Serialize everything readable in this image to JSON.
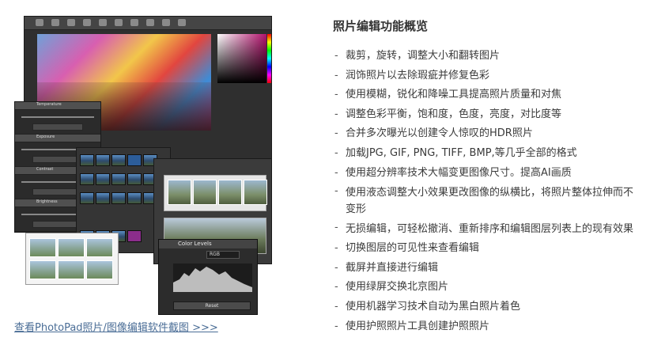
{
  "screenshot_link": {
    "text": "查看PhotoPad照片/图像编辑软件截图 >>>"
  },
  "embedded_screenshot": {
    "adjust_panels": [
      "Temperature",
      "Exposure",
      "Contrast",
      "Brightness"
    ],
    "levels_panel": {
      "title": "Color Levels",
      "channel": "RGB",
      "reset_label": "Reset"
    }
  },
  "features": {
    "title": "照片编辑功能概览",
    "items": [
      "裁剪，旋转，调整大小和翻转图片",
      "润饰照片以去除瑕疵并修复色彩",
      "使用模糊，锐化和降噪工具提高照片质量和对焦",
      "调整色彩平衡，饱和度，色度，亮度，对比度等",
      "合并多次曝光以创建令人惊叹的HDR照片",
      "加载JPG, GIF, PNG, TIFF, BMP,等几乎全部的格式",
      "使用超分辨率技术大幅变更图像尺寸。提高AI画质",
      "使用液态调整大小效果更改图像的纵横比，将照片整体拉伸而不变形",
      "无损编辑，可轻松撤消、重新排序和编辑图层列表上的现有效果",
      "切换图层的可见性来查看编辑",
      "截屏并直接进行编辑",
      "使用绿屏交换北京图片",
      "使用机器学习技术自动为黑白照片着色",
      "使用护照照片工具创建护照照片"
    ]
  }
}
